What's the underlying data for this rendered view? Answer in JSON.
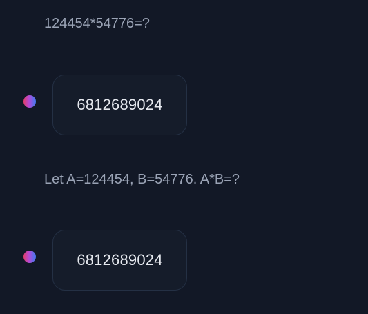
{
  "conversation": {
    "messages": [
      {
        "role": "user",
        "text": "124454*54776=?"
      },
      {
        "role": "assistant",
        "text": "6812689024",
        "avatar_icon": "gradient-dot-avatar"
      },
      {
        "role": "user",
        "text": "Let A=124454, B=54776. A*B=?"
      },
      {
        "role": "assistant",
        "text": "6812689024",
        "avatar_icon": "gradient-dot-avatar"
      }
    ]
  },
  "colors": {
    "background": "#121826",
    "user_text": "#9aa3b5",
    "assistant_text": "#e6e9ef",
    "bubble_bg": "#151c2a",
    "bubble_border": "#243044",
    "avatar_gradient": [
      "#e23d6a",
      "#b44ad6",
      "#3d7bf2"
    ]
  }
}
